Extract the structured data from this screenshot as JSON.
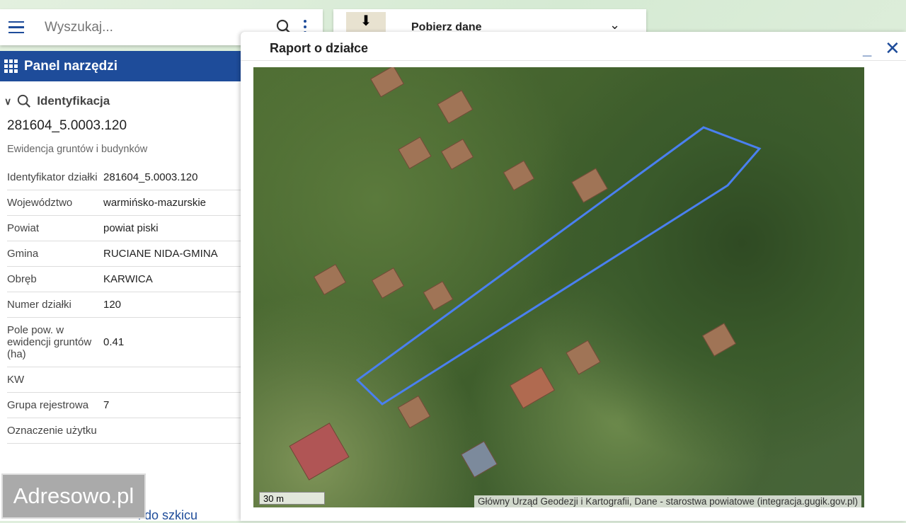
{
  "search": {
    "placeholder": "Wyszukaj..."
  },
  "download": {
    "label": "Pobierz dane"
  },
  "panel": {
    "title": "Panel narzędzi",
    "section": "Identyfikacja",
    "parcel_id": "281604_5.0003.120",
    "subtitle": "Ewidencja gruntów i budynków",
    "rows": [
      {
        "k": "Identyfikator działki",
        "v": "281604_5.0003.120"
      },
      {
        "k": "Województwo",
        "v": "warmińsko-mazurskie"
      },
      {
        "k": "Powiat",
        "v": "powiat piski"
      },
      {
        "k": "Gmina",
        "v": "RUCIANE NIDA-GMINA"
      },
      {
        "k": "Obręb",
        "v": "KARWICA"
      },
      {
        "k": "Numer działki",
        "v": "120"
      },
      {
        "k": "Pole pow. w ewidencji gruntów (ha)",
        "v": "0.41"
      },
      {
        "k": "KW",
        "v": ""
      },
      {
        "k": "Grupa rejestrowa",
        "v": "7"
      },
      {
        "k": "Oznaczenie użytku",
        "v": ""
      }
    ],
    "link": "i do szkicu"
  },
  "watermark": "Adresowo.pl",
  "dialog": {
    "title": "Raport o działce",
    "minimize": "_",
    "close": "✕",
    "scale": "30 m",
    "attribution": "Główny Urząd Geodezji i Kartografii, Dane - starostwa powiatowe (integracja.gugik.gov.pl)",
    "parcel_color": "#4a80f0"
  },
  "colors": {
    "accent": "#1e4c9a"
  }
}
